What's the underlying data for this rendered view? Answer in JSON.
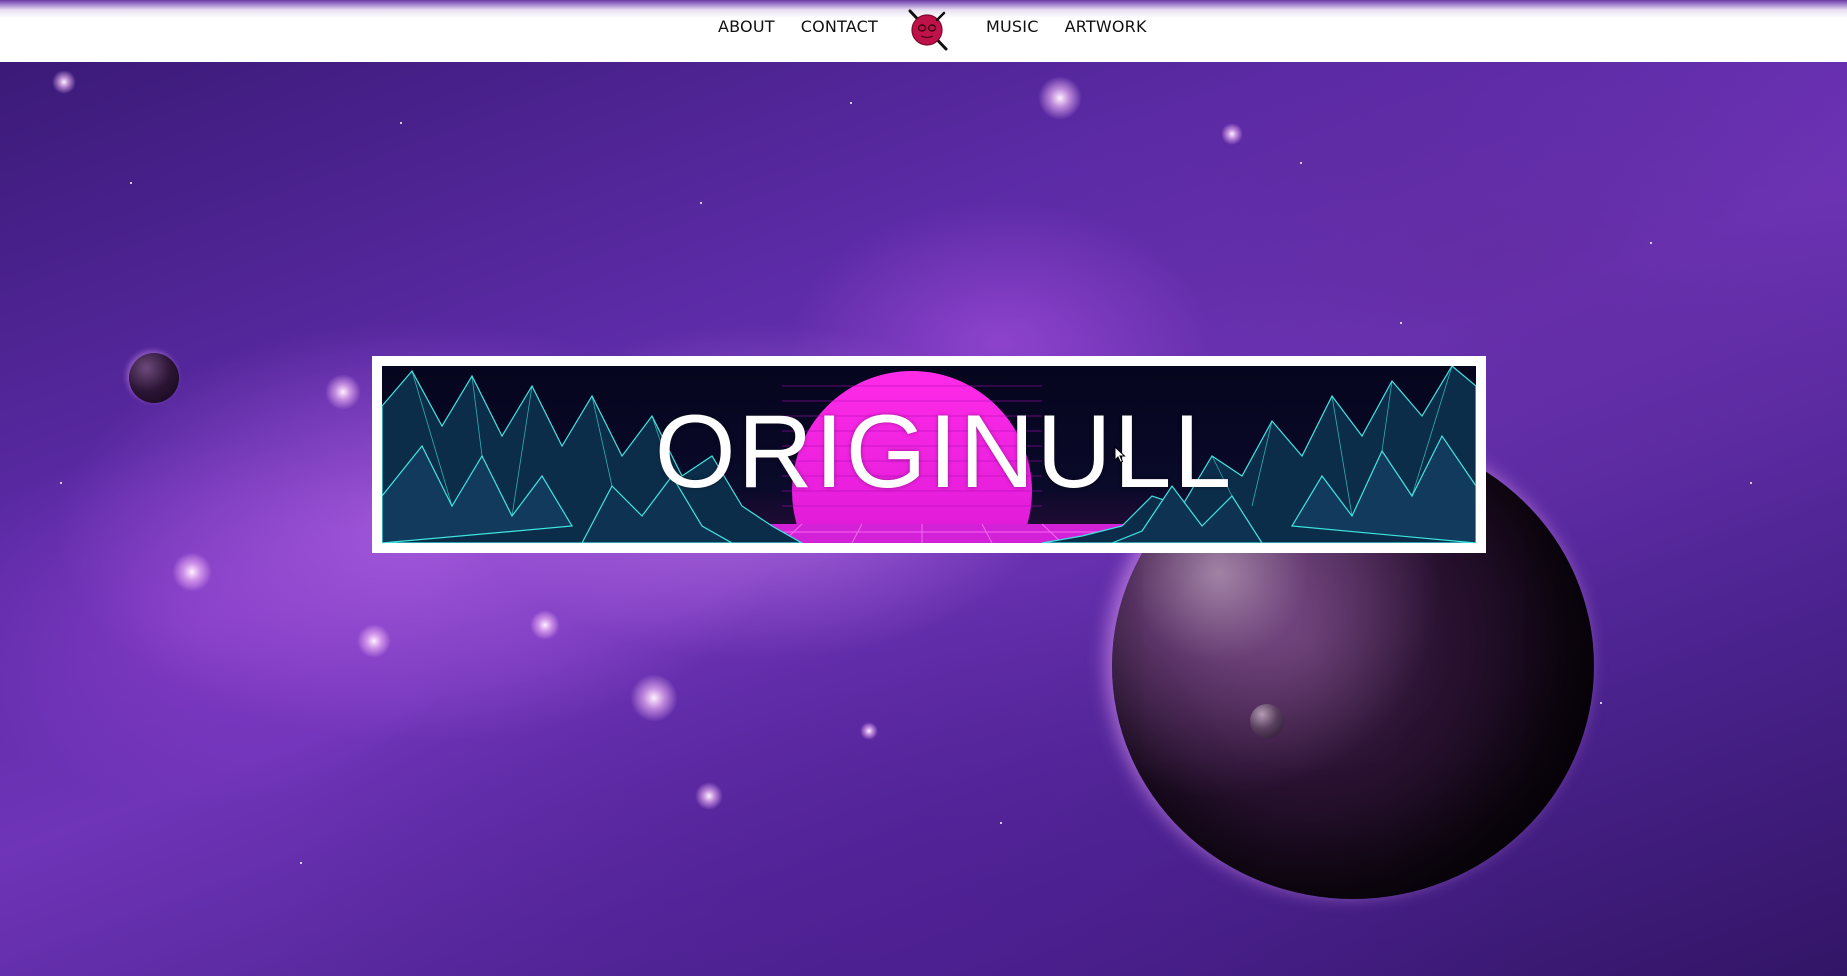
{
  "nav": {
    "left": [
      {
        "label": "ABOUT"
      },
      {
        "label": "CONTACT"
      }
    ],
    "right": [
      {
        "label": "MUSIC"
      },
      {
        "label": "ARTWORK"
      }
    ],
    "logo_icon": "skull-knife-logo-icon"
  },
  "hero": {
    "banner_title": "ORIGINULL"
  },
  "colors": {
    "topbar_accent": "#6a3aa6",
    "banner_sun": "#ff1fe6",
    "banner_mountains": "#3ee6e0",
    "hero_purple": "#6f34b8"
  }
}
